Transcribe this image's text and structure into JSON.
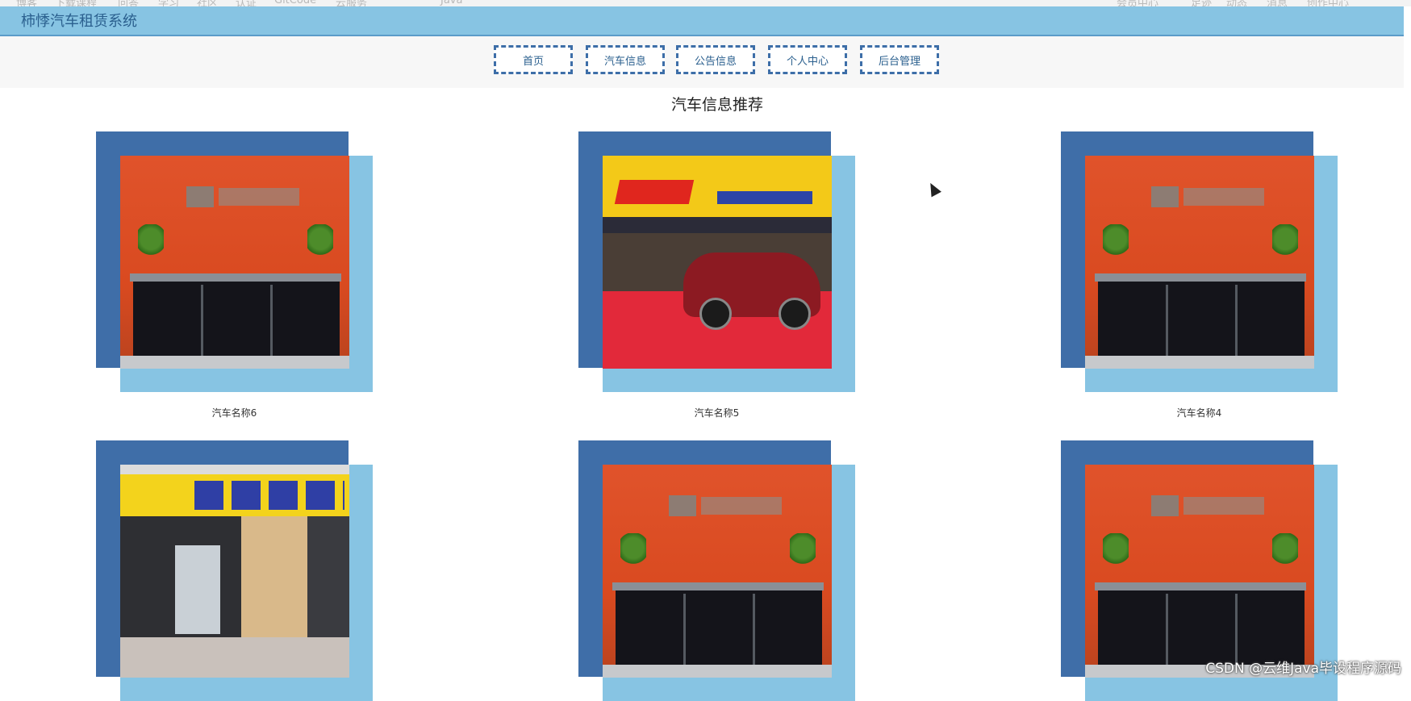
{
  "window": {
    "title": "柿悸汽车租赁系统"
  },
  "browser_strip": [
    "博客",
    "下载课程",
    "问答",
    "学习",
    "社区",
    "认证",
    "GitCode",
    "云服务",
    "Java",
    "会员中心",
    "足迹",
    "动态",
    "消息",
    "创作中心"
  ],
  "nav": {
    "items": [
      {
        "label": "首页"
      },
      {
        "label": "汽车信息"
      },
      {
        "label": "公告信息"
      },
      {
        "label": "个人中心"
      },
      {
        "label": "后台管理"
      }
    ]
  },
  "section": {
    "title": "汽车信息推荐"
  },
  "cards": [
    {
      "name": "汽车名称6",
      "image": "office-lobby-photo"
    },
    {
      "name": "汽车名称5",
      "image": "car-showroom-photo"
    },
    {
      "name": "汽车名称4",
      "image": "office-lobby-photo"
    },
    {
      "name": "",
      "image": "rental-storefront-photo"
    },
    {
      "name": "",
      "image": "office-lobby-photo"
    },
    {
      "name": "",
      "image": "office-lobby-photo"
    }
  ],
  "watermark": "CSDN @云维Java毕设程序源码",
  "colors": {
    "header": "#87c4e3",
    "nav_border": "#3d6ea8",
    "card_back": "#3f6ea8",
    "card_front": "#87c4e3"
  }
}
